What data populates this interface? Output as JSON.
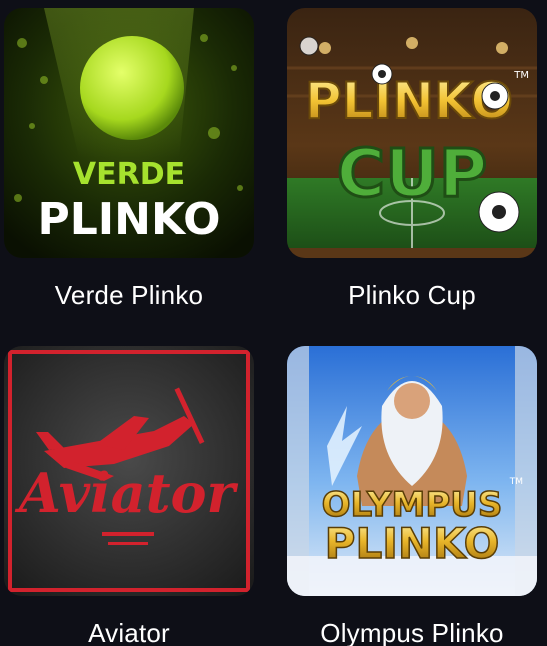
{
  "games": [
    {
      "title": "Verde Plinko",
      "art_line1": "VERDE",
      "art_line2": "PLINKO"
    },
    {
      "title": "Plinko Cup",
      "art_line1": "PLINKO",
      "art_line2": "CUP",
      "trademark": "TM"
    },
    {
      "title": "Aviator",
      "art_line1": "Aviator"
    },
    {
      "title": "Olympus Plinko",
      "art_line1": "OLYMPUS",
      "art_line2": "PLINKO",
      "trademark": "TM"
    }
  ],
  "colors": {
    "background": "#0e0f17",
    "text": "#ffffff",
    "verde_green": "#a6e22e",
    "aviator_red": "#d2222d",
    "plinko_gold": "#f2c233",
    "cup_green": "#4fae3a"
  }
}
